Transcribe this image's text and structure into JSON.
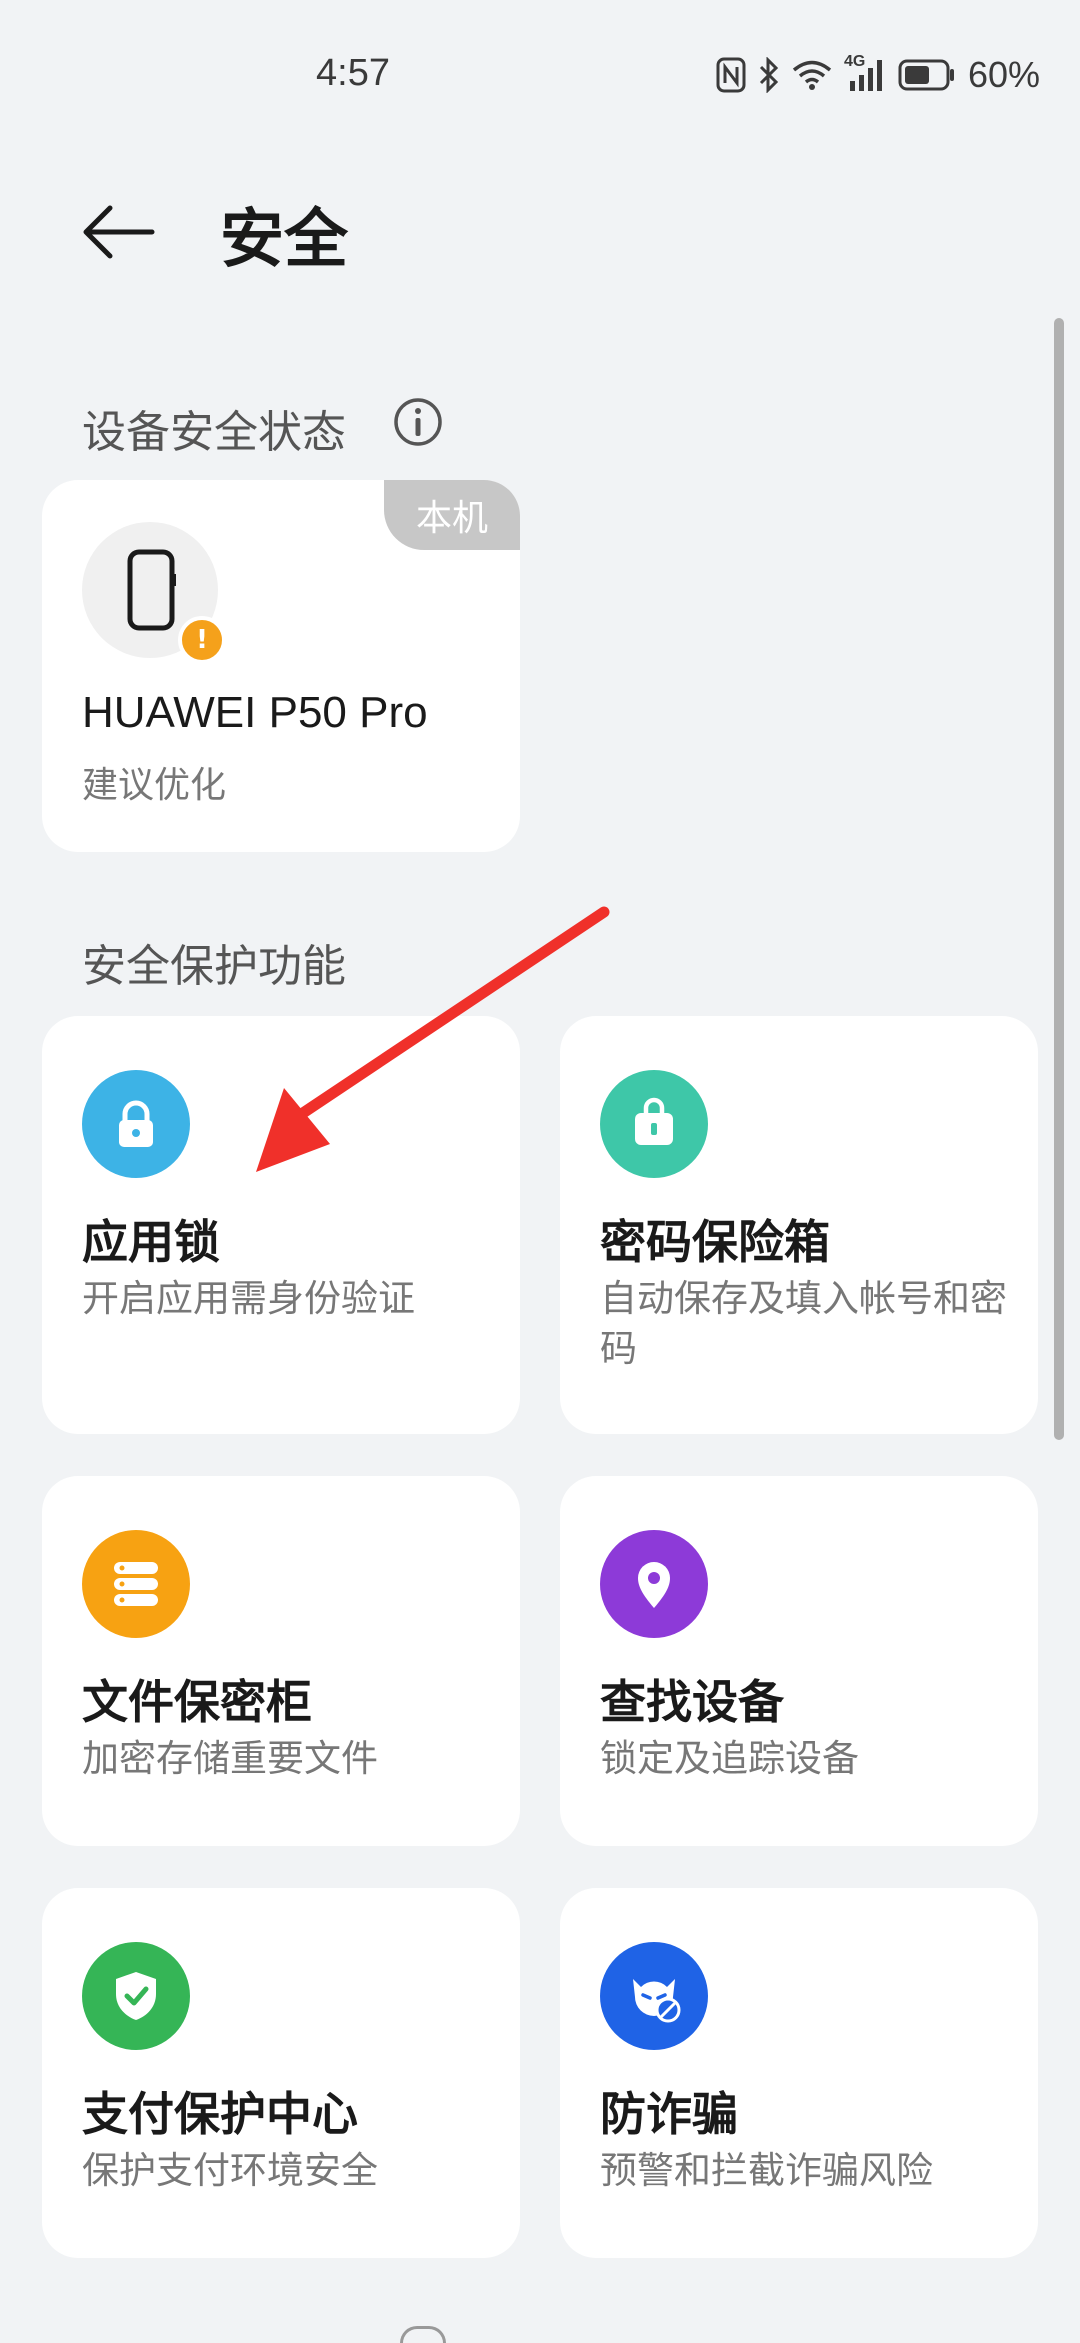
{
  "status_bar": {
    "time": "4:57",
    "battery": "60%",
    "network": "4G"
  },
  "header": {
    "title": "安全"
  },
  "device_section": {
    "title": "设备安全状态",
    "card": {
      "badge": "本机",
      "name": "HUAWEI P50 Pro",
      "status": "建议优化"
    }
  },
  "features_section": {
    "title": "安全保护功能",
    "items": [
      {
        "title": "应用锁",
        "desc": "开启应用需身份验证",
        "icon": "lock-icon",
        "color": "#3db3e6"
      },
      {
        "title": "密码保险箱",
        "desc": "自动保存及填入帐号和密码",
        "icon": "safe-icon",
        "color": "#3ec7a8"
      },
      {
        "title": "文件保密柜",
        "desc": "加密存储重要文件",
        "icon": "file-cabinet-icon",
        "color": "#f7a212"
      },
      {
        "title": "查找设备",
        "desc": "锁定及追踪设备",
        "icon": "location-pin-icon",
        "color": "#8d3ad8"
      },
      {
        "title": "支付保护中心",
        "desc": "保护支付环境安全",
        "icon": "shield-check-icon",
        "color": "#35b556"
      },
      {
        "title": "防诈骗",
        "desc": "预警和拦截诈骗风险",
        "icon": "anti-fraud-icon",
        "color": "#1f63e6"
      }
    ]
  },
  "colors": {
    "background": "#f1f3f5",
    "card": "#ffffff",
    "annotation_arrow": "#f0302a"
  }
}
